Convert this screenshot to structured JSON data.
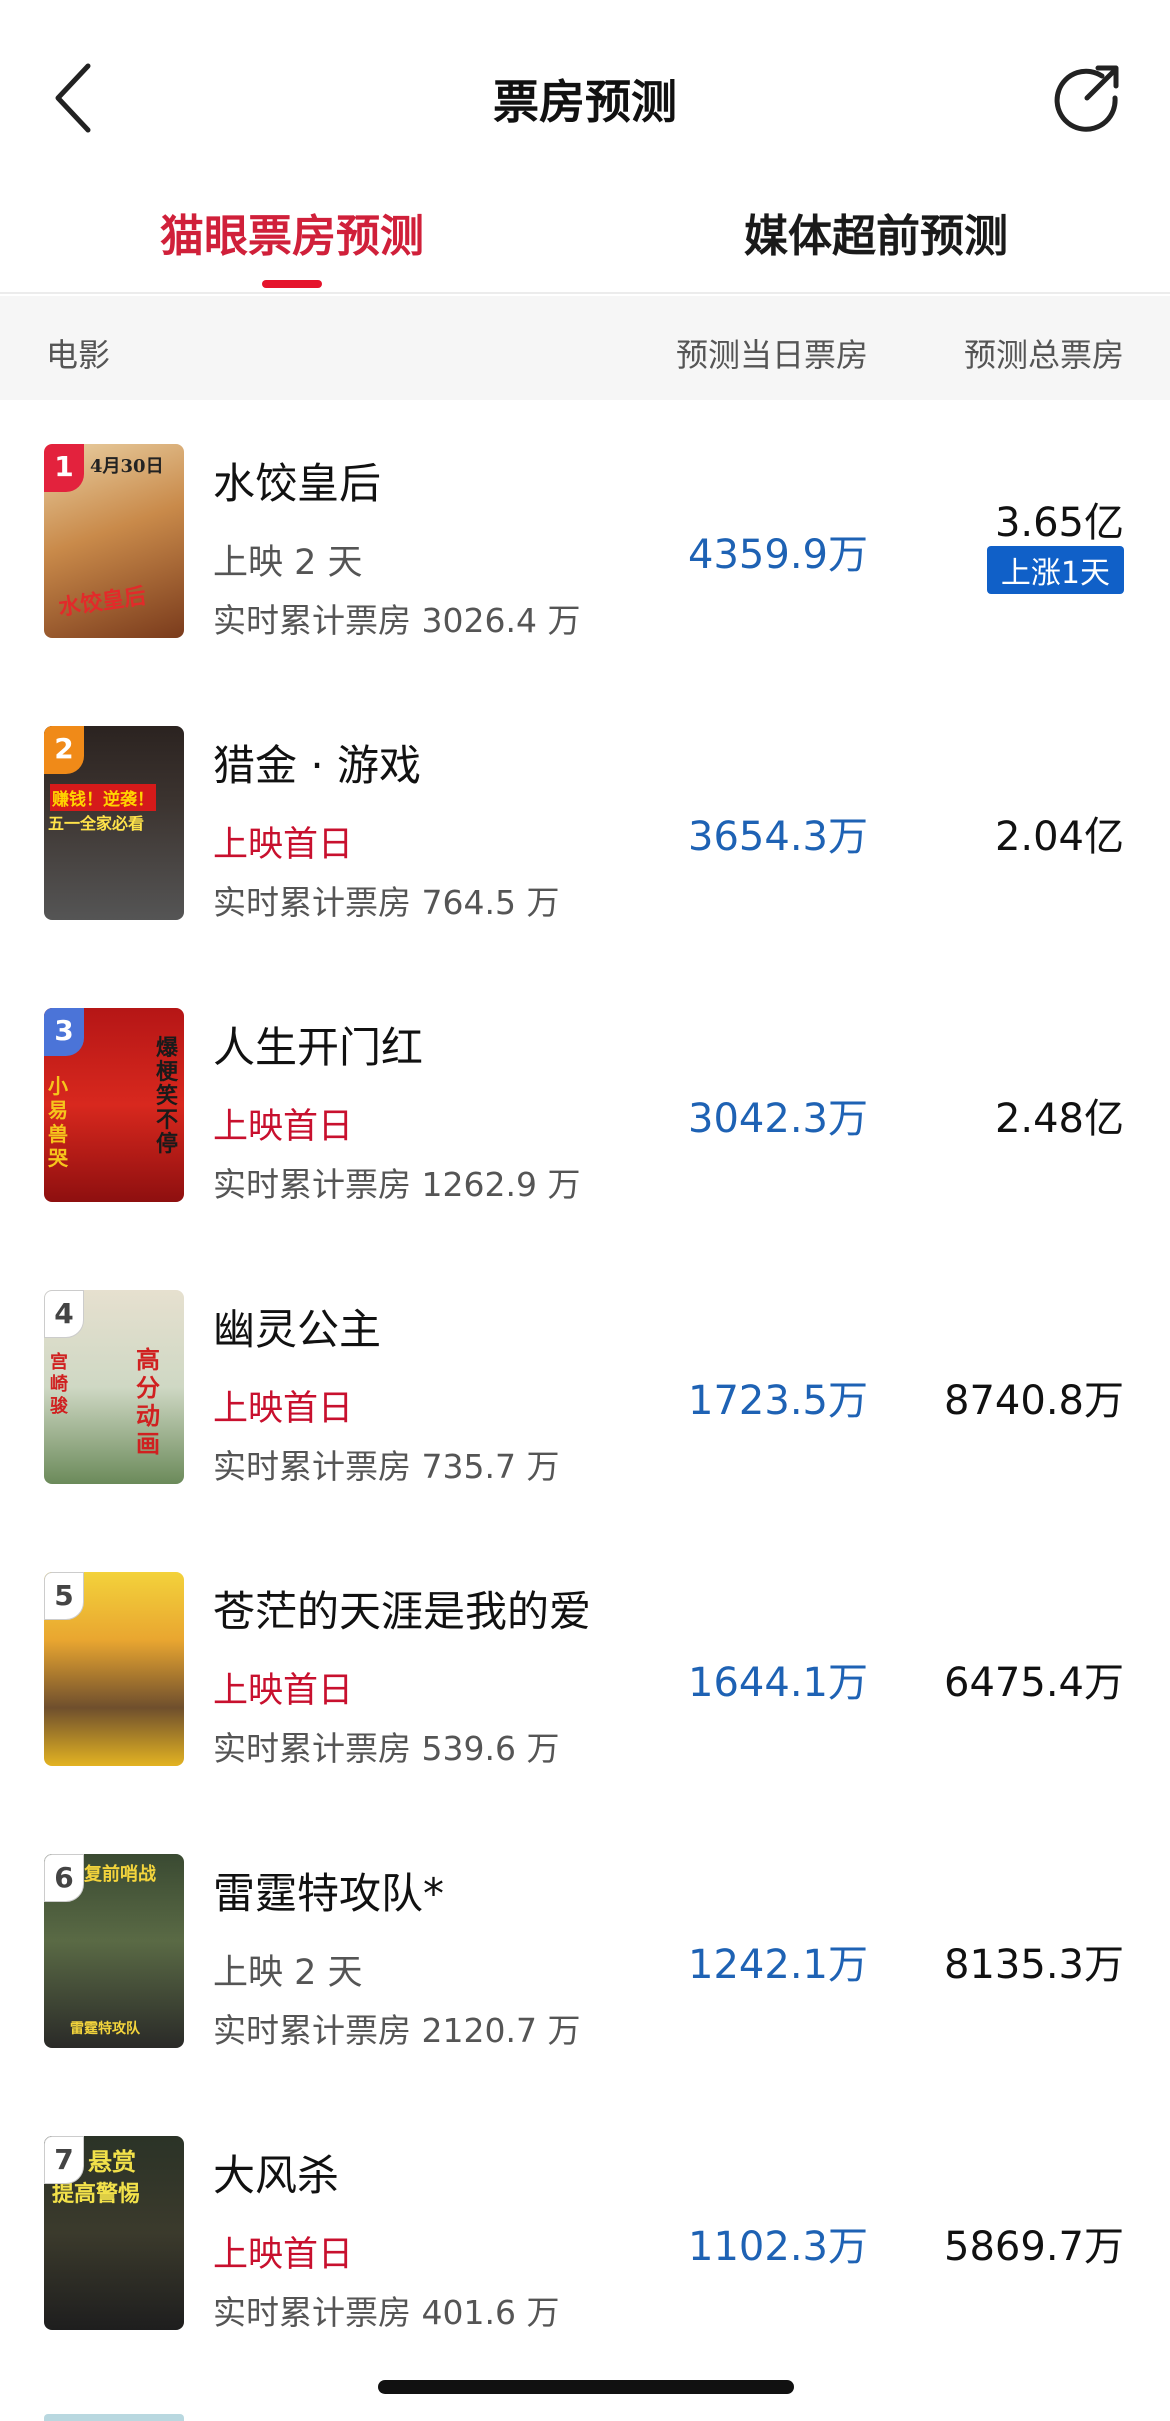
{
  "header": {
    "title": "票房预测",
    "back_icon": "chevron-left-icon",
    "share_icon": "share-icon"
  },
  "tabs": [
    {
      "label": "猫眼票房预测",
      "active": true
    },
    {
      "label": "媒体超前预测",
      "active": false
    }
  ],
  "columns": {
    "movie": "电影",
    "today": "预测当日票房",
    "total": "预测总票房"
  },
  "colors": {
    "accent_red": "#e5142c",
    "blue_value": "#1e62b4",
    "badge_blue": "#1060c8"
  },
  "movies": [
    {
      "rank": "1",
      "title": "水饺皇后",
      "release": "上映 2 天",
      "first_day": false,
      "realtime": "实时累计票房 3026.4 万",
      "today_num": "4359.9",
      "today_unit": "万",
      "total_num": "3.65",
      "total_unit": "亿",
      "badge": "上涨1天",
      "poster_text": "4月30日",
      "poster_text2": "水饺皇后"
    },
    {
      "rank": "2",
      "title": "猎金 · 游戏",
      "release": "上映首日",
      "first_day": true,
      "realtime": "实时累计票房 764.5 万",
      "today_num": "3654.3",
      "today_unit": "万",
      "total_num": "2.04",
      "total_unit": "亿",
      "badge": "",
      "poster_text": "赚钱！逆袭！",
      "poster_text2": "五一全家必看"
    },
    {
      "rank": "3",
      "title": "人生开门红",
      "release": "上映首日",
      "first_day": true,
      "realtime": "实时累计票房 1262.9 万",
      "today_num": "3042.3",
      "today_unit": "万",
      "total_num": "2.48",
      "total_unit": "亿",
      "badge": "",
      "poster_text": "爆梗笑不停",
      "poster_text2": "小易兽哭"
    },
    {
      "rank": "4",
      "title": "幽灵公主",
      "release": "上映首日",
      "first_day": true,
      "realtime": "实时累计票房 735.7 万",
      "today_num": "1723.5",
      "today_unit": "万",
      "total_num": "8740.8",
      "total_unit": "万",
      "badge": "",
      "poster_text": "高分动画",
      "poster_text2": "宫崎骏"
    },
    {
      "rank": "5",
      "title": "苍茫的天涯是我的爱",
      "release": "上映首日",
      "first_day": true,
      "realtime": "实时累计票房 539.6 万",
      "today_num": "1644.1",
      "today_unit": "万",
      "total_num": "6475.4",
      "total_unit": "万",
      "badge": "",
      "poster_text": "",
      "poster_text2": ""
    },
    {
      "rank": "6",
      "title": "雷霆特攻队*",
      "release": "上映 2 天",
      "first_day": false,
      "realtime": "实时累计票房 2120.7 万",
      "today_num": "1242.1",
      "today_unit": "万",
      "total_num": "8135.3",
      "total_unit": "万",
      "badge": "",
      "poster_text": "复前哨战",
      "poster_text2": "雷霆特攻队"
    },
    {
      "rank": "7",
      "title": "大风杀",
      "release": "上映首日",
      "first_day": true,
      "realtime": "实时累计票房 401.6 万",
      "today_num": "1102.3",
      "today_unit": "万",
      "total_num": "5869.7",
      "total_unit": "万",
      "badge": "",
      "poster_text": "悬赏",
      "poster_text2": "提高警惕"
    }
  ]
}
